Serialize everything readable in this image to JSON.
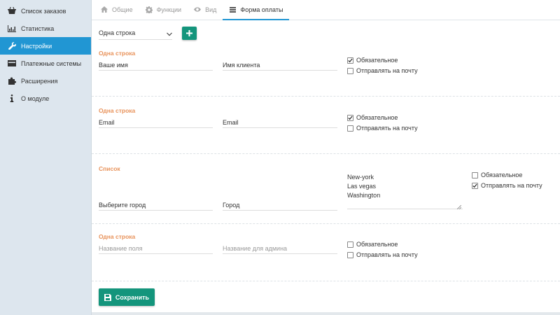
{
  "sidebar": {
    "items": [
      {
        "label": "Список заказов",
        "icon": "basket-icon"
      },
      {
        "label": "Статистика",
        "icon": "bar-chart-icon"
      },
      {
        "label": "Настройки",
        "icon": "wrench-icon",
        "active": true
      },
      {
        "label": "Платежные системы",
        "icon": "credit-card-icon"
      },
      {
        "label": "Расширения",
        "icon": "puzzle-icon"
      },
      {
        "label": "О модуле",
        "icon": "info-icon"
      }
    ]
  },
  "tabs": [
    {
      "label": "Общие",
      "icon": "home-icon"
    },
    {
      "label": "Функции",
      "icon": "gear-icon"
    },
    {
      "label": "Вид",
      "icon": "eye-icon"
    },
    {
      "label": "Форма оплаты",
      "icon": "list-icon",
      "active": true
    }
  ],
  "toolbar": {
    "field_type_selected": "Одна строка",
    "add_icon": "plus-icon"
  },
  "fields": [
    {
      "title": "Одна строка",
      "name_value": "Ваше имя",
      "admin_value": "Имя клиента",
      "required_label": "Обязательное",
      "required": true,
      "email_label": "Отправлять на почту",
      "send_email": false
    },
    {
      "title": "Одна строка",
      "name_value": "Email",
      "admin_value": "Email",
      "required_label": "Обязательное",
      "required": true,
      "email_label": "Отправлять на почту",
      "send_email": false
    },
    {
      "title": "Список",
      "name_value": "Выберите город",
      "admin_value": "Город",
      "options": [
        "New-york",
        "Las vegas",
        "Washington"
      ],
      "required_label": "Обязательное",
      "required": false,
      "email_label": "Отправлять на почту",
      "send_email": true
    },
    {
      "title": "Одна строка",
      "name_placeholder": "Название поля",
      "admin_placeholder": "Название для админа",
      "required_label": "Обязательное",
      "required": false,
      "email_label": "Отправлять на почту",
      "send_email": false
    }
  ],
  "save_button": {
    "label": "Сохранить",
    "icon": "floppy-icon"
  },
  "colors": {
    "accent": "#2196d3",
    "primary_button": "#14957c",
    "field_title": "#e8925a"
  }
}
